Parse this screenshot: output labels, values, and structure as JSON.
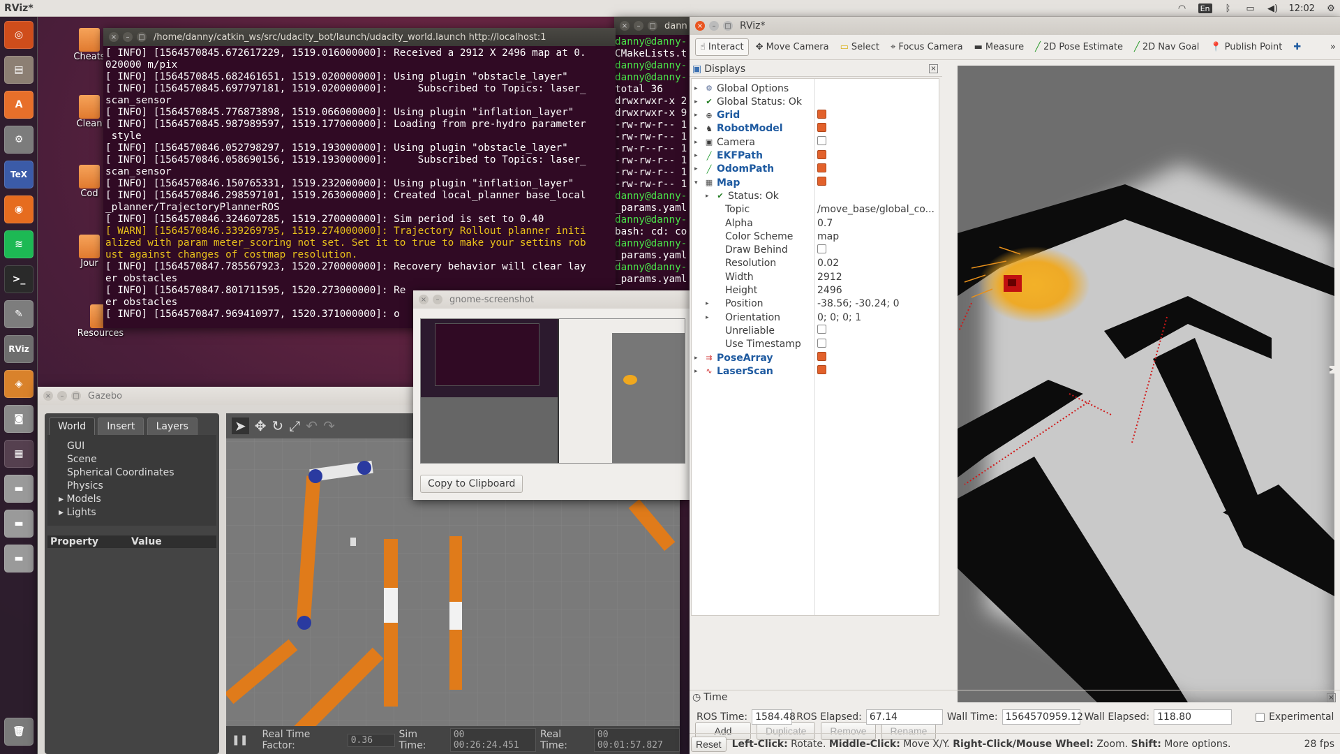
{
  "panel": {
    "app_title": "RViz*",
    "keyboard": "En",
    "clock": "12:02"
  },
  "desktop_icons": [
    {
      "label": "Cheats"
    },
    {
      "label": "Clean"
    },
    {
      "label": "Cod"
    },
    {
      "label": "Jour"
    },
    {
      "label": "Resources"
    }
  ],
  "launcher": {
    "items": [
      "ubuntu-dash",
      "files",
      "software-center",
      "system-settings",
      "texmaker",
      "firefox",
      "spotify",
      "terminal",
      "text-editor",
      "rviz",
      "gazebo",
      "camera",
      "workspace",
      "drive-1",
      "drive-2",
      "drive-3",
      "trash"
    ]
  },
  "terminal_main": {
    "title": "/home/danny/catkin_ws/src/udacity_bot/launch/udacity_world.launch http://localhost:1",
    "lines": [
      {
        "t": "[ INFO] [1564570845.672617229, 1519.016000000]: Received a 2912 X 2496 map at 0.",
        "w": false
      },
      {
        "t": "020000 m/pix",
        "w": false
      },
      {
        "t": "[ INFO] [1564570845.682461651, 1519.020000000]: Using plugin \"obstacle_layer\"",
        "w": false
      },
      {
        "t": "[ INFO] [1564570845.697797181, 1519.020000000]:     Subscribed to Topics: laser_",
        "w": false
      },
      {
        "t": "scan_sensor",
        "w": false
      },
      {
        "t": "[ INFO] [1564570845.776873898, 1519.066000000]: Using plugin \"inflation_layer\"",
        "w": false
      },
      {
        "t": "[ INFO] [1564570845.987989597, 1519.177000000]: Loading from pre-hydro parameter",
        "w": false
      },
      {
        "t": " style",
        "w": false
      },
      {
        "t": "[ INFO] [1564570846.052798297, 1519.193000000]: Using plugin \"obstacle_layer\"",
        "w": false
      },
      {
        "t": "[ INFO] [1564570846.058690156, 1519.193000000]:     Subscribed to Topics: laser_",
        "w": false
      },
      {
        "t": "scan_sensor",
        "w": false
      },
      {
        "t": "[ INFO] [1564570846.150765331, 1519.232000000]: Using plugin \"inflation_layer\"",
        "w": false
      },
      {
        "t": "[ INFO] [1564570846.298597101, 1519.263000000]: Created local_planner base_local",
        "w": false
      },
      {
        "t": "_planner/TrajectoryPlannerROS",
        "w": false
      },
      {
        "t": "[ INFO] [1564570846.324607285, 1519.270000000]: Sim period is set to 0.40",
        "w": false
      },
      {
        "t": "[ WARN] [1564570846.339269795, 1519.274000000]: Trajectory Rollout planner initi",
        "w": true
      },
      {
        "t": "alized with param meter_scoring not set. Set it to true to make your settins rob",
        "w": true
      },
      {
        "t": "ust against changes of costmap resolution.",
        "w": true
      },
      {
        "t": "[ INFO] [1564570847.785567923, 1520.270000000]: Recovery behavior will clear lay",
        "w": false
      },
      {
        "t": "er obstacles",
        "w": false
      },
      {
        "t": "[ INFO] [1564570847.801711595, 1520.273000000]: Re",
        "w": false
      },
      {
        "t": "er obstacles",
        "w": false
      },
      {
        "t": "[ INFO] [1564570847.969410977, 1520.371000000]: o",
        "w": false
      }
    ]
  },
  "terminal_side": {
    "title": "dann",
    "lines": [
      {
        "t": "danny@danny-",
        "g": true
      },
      {
        "t": "CMakeLists.t",
        "g": false
      },
      {
        "t": "danny@danny-",
        "g": true
      },
      {
        "t": "danny@danny-",
        "g": true
      },
      {
        "t": "total 36",
        "g": false
      },
      {
        "t": "drwxrwxr-x 2",
        "g": false
      },
      {
        "t": "drwxrwxr-x 9",
        "g": false
      },
      {
        "t": "-rw-rw-r-- 1",
        "g": false
      },
      {
        "t": "-rw-rw-r-- 1",
        "g": false
      },
      {
        "t": "-rw-r--r-- 1",
        "g": false
      },
      {
        "t": "-rw-rw-r-- 1",
        "g": false
      },
      {
        "t": "-rw-rw-r-- 1",
        "g": false
      },
      {
        "t": "-rw-rw-r-- 1",
        "g": false
      },
      {
        "t": "danny@danny-",
        "g": true
      },
      {
        "t": "_params.yaml",
        "g": false
      },
      {
        "t": "danny@danny-",
        "g": true
      },
      {
        "t": "bash: cd: co",
        "g": false
      },
      {
        "t": "danny@danny-",
        "g": true
      },
      {
        "t": "_params.yaml",
        "g": false
      },
      {
        "t": "danny@danny-",
        "g": true
      },
      {
        "t": "_params.yaml",
        "g": false
      }
    ]
  },
  "gazebo": {
    "title": "Gazebo",
    "tabs": [
      "World",
      "Insert",
      "Layers"
    ],
    "tree": [
      "GUI",
      "Scene",
      "Spherical Coordinates",
      "Physics",
      "Models",
      "Lights"
    ],
    "prop_header": {
      "property": "Property",
      "value": "Value"
    },
    "status": {
      "rtf_label": "Real Time Factor:",
      "rtf": "0.36",
      "sim_label": "Sim Time:",
      "sim": "00 00:26:24.451",
      "real_label": "Real Time:",
      "real": "00 00:01:57.827"
    }
  },
  "screenshot_dialog": {
    "title": "gnome-screenshot",
    "copy_label": "Copy to Clipboard"
  },
  "rviz": {
    "title": "RViz*",
    "tools": [
      "Interact",
      "Move Camera",
      "Select",
      "Focus Camera",
      "Measure",
      "2D Pose Estimate",
      "2D Nav Goal",
      "Publish Point"
    ],
    "displays_title": "Displays",
    "rows": [
      {
        "name": "Global Options",
        "indent": 0,
        "exp": "▸",
        "icon": "gear-icon",
        "glyph": "⚙",
        "color": "#5b6f99",
        "check": null,
        "bold": false,
        "val": ""
      },
      {
        "name": "Global Status: Ok",
        "indent": 0,
        "exp": "▸",
        "icon": "checkmark-icon",
        "glyph": "✔",
        "color": "#1e7a1e",
        "check": null,
        "bold": false,
        "val": ""
      },
      {
        "name": "Grid",
        "indent": 0,
        "exp": "▸",
        "icon": "grid-icon",
        "glyph": "⊕",
        "color": "#3a3a3a",
        "check": true,
        "bold": true,
        "val": ""
      },
      {
        "name": "RobotModel",
        "indent": 0,
        "exp": "▸",
        "icon": "robot-icon",
        "glyph": "♞",
        "color": "#3a3a3a",
        "check": true,
        "bold": true,
        "val": ""
      },
      {
        "name": "Camera",
        "indent": 0,
        "exp": "▸",
        "icon": "camera-icon",
        "glyph": "▣",
        "color": "#3a3a3a",
        "check": false,
        "bold": false,
        "val": ""
      },
      {
        "name": "EKFPath",
        "indent": 0,
        "exp": "▸",
        "icon": "path-icon",
        "glyph": "╱",
        "color": "#1e9a2e",
        "check": true,
        "bold": true,
        "val": ""
      },
      {
        "name": "OdomPath",
        "indent": 0,
        "exp": "▸",
        "icon": "path-icon",
        "glyph": "╱",
        "color": "#1e9a2e",
        "check": true,
        "bold": true,
        "val": ""
      },
      {
        "name": "Map",
        "indent": 0,
        "exp": "▾",
        "icon": "map-icon",
        "glyph": "▦",
        "color": "#555",
        "check": true,
        "bold": true,
        "val": ""
      },
      {
        "name": "Status: Ok",
        "indent": 1,
        "exp": "▸",
        "icon": "checkmark-icon",
        "glyph": "✔",
        "color": "#1e7a1e",
        "check": null,
        "bold": false,
        "val": ""
      },
      {
        "name": "Topic",
        "indent": 1,
        "exp": "",
        "icon": "",
        "glyph": "",
        "color": "",
        "check": null,
        "bold": false,
        "val": "/move_base/global_co..."
      },
      {
        "name": "Alpha",
        "indent": 1,
        "exp": "",
        "icon": "",
        "glyph": "",
        "color": "",
        "check": null,
        "bold": false,
        "val": "0.7"
      },
      {
        "name": "Color Scheme",
        "indent": 1,
        "exp": "",
        "icon": "",
        "glyph": "",
        "color": "",
        "check": null,
        "bold": false,
        "val": "map"
      },
      {
        "name": "Draw Behind",
        "indent": 1,
        "exp": "",
        "icon": "",
        "glyph": "",
        "color": "",
        "check": null,
        "bold": false,
        "val": "",
        "vcheck": false
      },
      {
        "name": "Resolution",
        "indent": 1,
        "exp": "",
        "icon": "",
        "glyph": "",
        "color": "",
        "check": null,
        "bold": false,
        "val": "0.02"
      },
      {
        "name": "Width",
        "indent": 1,
        "exp": "",
        "icon": "",
        "glyph": "",
        "color": "",
        "check": null,
        "bold": false,
        "val": "2912"
      },
      {
        "name": "Height",
        "indent": 1,
        "exp": "",
        "icon": "",
        "glyph": "",
        "color": "",
        "check": null,
        "bold": false,
        "val": "2496"
      },
      {
        "name": "Position",
        "indent": 1,
        "exp": "▸",
        "icon": "",
        "glyph": "",
        "color": "",
        "check": null,
        "bold": false,
        "val": "-38.56; -30.24; 0"
      },
      {
        "name": "Orientation",
        "indent": 1,
        "exp": "▸",
        "icon": "",
        "glyph": "",
        "color": "",
        "check": null,
        "bold": false,
        "val": "0; 0; 0; 1"
      },
      {
        "name": "Unreliable",
        "indent": 1,
        "exp": "",
        "icon": "",
        "glyph": "",
        "color": "",
        "check": null,
        "bold": false,
        "val": "",
        "vcheck": false
      },
      {
        "name": "Use Timestamp",
        "indent": 1,
        "exp": "",
        "icon": "",
        "glyph": "",
        "color": "",
        "check": null,
        "bold": false,
        "val": "",
        "vcheck": false
      },
      {
        "name": "PoseArray",
        "indent": 0,
        "exp": "▸",
        "icon": "pose-array-icon",
        "glyph": "⇉",
        "color": "#d03030",
        "check": true,
        "bold": true,
        "val": ""
      },
      {
        "name": "LaserScan",
        "indent": 0,
        "exp": "▸",
        "icon": "laser-scan-icon",
        "glyph": "∿",
        "color": "#d03030",
        "check": true,
        "bold": true,
        "val": ""
      }
    ],
    "buttons": [
      "Add",
      "Duplicate",
      "Remove",
      "Rename"
    ],
    "time": {
      "title": "Time",
      "ros_time_label": "ROS Time:",
      "ros_time": "1584.48",
      "ros_elapsed_label": "ROS Elapsed:",
      "ros_elapsed": "67.14",
      "wall_time_label": "Wall Time:",
      "wall_time": "1564570959.12",
      "wall_elapsed_label": "Wall Elapsed:",
      "wall_elapsed": "118.80",
      "experimental_label": "Experimental"
    },
    "status": {
      "reset": "Reset",
      "hint_a": "Left-Click:",
      "hint_b": " Rotate. ",
      "hint_c": "Middle-Click:",
      "hint_d": " Move X/Y. ",
      "hint_e": "Right-Click/Mouse Wheel:",
      "hint_f": " Zoom. ",
      "hint_g": "Shift:",
      "hint_h": " More options.",
      "fps": "28 fps"
    }
  },
  "colors": {
    "accent": "#e95420",
    "terminal_bg": "#300a24",
    "warn": "#e8c11c",
    "prompt": "#4ae34a",
    "particles": "#f0a81e"
  }
}
